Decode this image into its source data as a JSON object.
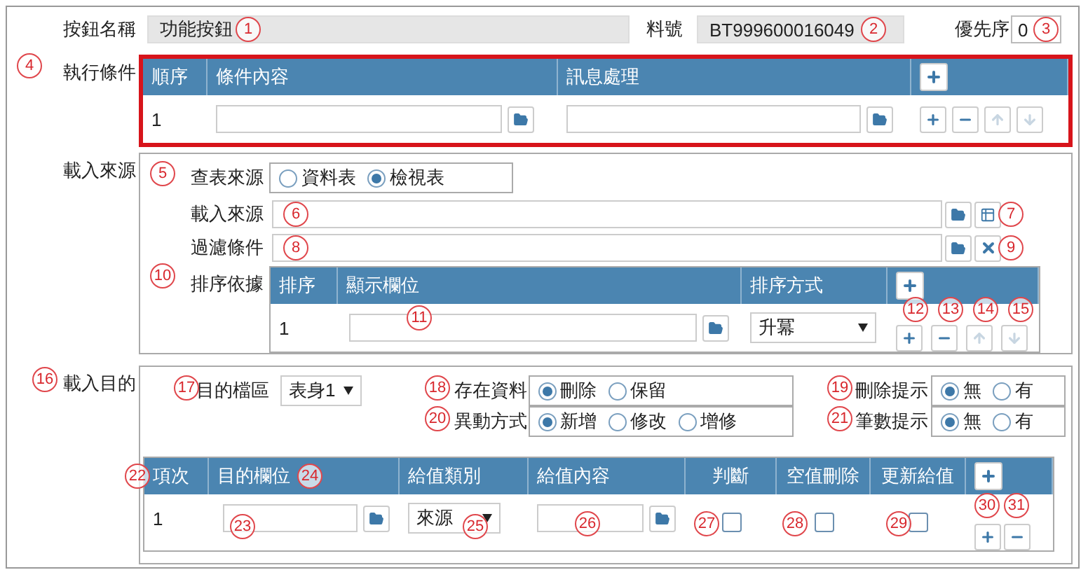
{
  "header": {
    "name_label": "按鈕名稱",
    "name_value": "功能按鈕",
    "part_label": "料號",
    "part_value": "BT999600016049",
    "priority_label": "優先序",
    "priority_value": "0"
  },
  "conditions": {
    "label": "執行條件",
    "columns": [
      "順序",
      "條件內容",
      "訊息處理"
    ],
    "rows": [
      {
        "index": "1",
        "actions": [
          {
            "kind": "add",
            "disabled": false
          },
          {
            "kind": "remove",
            "disabled": false
          },
          {
            "kind": "up",
            "disabled": true
          },
          {
            "kind": "down",
            "disabled": true
          }
        ]
      }
    ]
  },
  "source": {
    "label": "載入來源",
    "lookup_label": "查表來源",
    "lookup_options": [
      {
        "label": "資料表",
        "selected": false
      },
      {
        "label": "檢視表",
        "selected": true
      }
    ],
    "source_label": "載入來源",
    "filter_label": "過濾條件",
    "sort_label": "排序依據",
    "sort_columns": [
      "排序",
      "顯示欄位",
      "排序方式"
    ],
    "sort_rows": [
      {
        "index": "1",
        "order": "升冪",
        "actions": [
          {
            "kind": "add",
            "disabled": false
          },
          {
            "kind": "remove",
            "disabled": false
          },
          {
            "kind": "up",
            "disabled": true
          },
          {
            "kind": "down",
            "disabled": true
          }
        ]
      }
    ]
  },
  "target": {
    "label": "載入目的",
    "area_label": "目的檔區",
    "area_value": "表身1",
    "groups": [
      {
        "label": "存在資料",
        "options": [
          {
            "label": "刪除",
            "selected": true
          },
          {
            "label": "保留",
            "selected": false
          }
        ]
      },
      {
        "label": "刪除提示",
        "options": [
          {
            "label": "無",
            "selected": true
          },
          {
            "label": "有",
            "selected": false
          }
        ]
      },
      {
        "label": "異動方式",
        "options": [
          {
            "label": "新增",
            "selected": true
          },
          {
            "label": "修改",
            "selected": false
          },
          {
            "label": "增修",
            "selected": false
          }
        ]
      },
      {
        "label": "筆數提示",
        "options": [
          {
            "label": "無",
            "selected": true
          },
          {
            "label": "有",
            "selected": false
          }
        ]
      }
    ],
    "columns": [
      "項次",
      "目的欄位",
      "給值類別",
      "給值內容",
      "判斷",
      "空值刪除",
      "更新給值"
    ],
    "rows": [
      {
        "index": "1",
        "value_type": "來源",
        "checks": [
          {
            "checked": false
          },
          {
            "checked": false
          },
          {
            "checked": false
          }
        ],
        "actions": [
          {
            "kind": "add",
            "disabled": false
          },
          {
            "kind": "remove",
            "disabled": false
          }
        ]
      }
    ]
  },
  "badges": [
    "1",
    "2",
    "3",
    "4",
    "5",
    "6",
    "7",
    "8",
    "9",
    "10",
    "11",
    "12",
    "13",
    "14",
    "15",
    "16",
    "17",
    "18",
    "19",
    "20",
    "21",
    "22",
    "23",
    "24",
    "25",
    "26",
    "27",
    "28",
    "29",
    "30",
    "31"
  ]
}
